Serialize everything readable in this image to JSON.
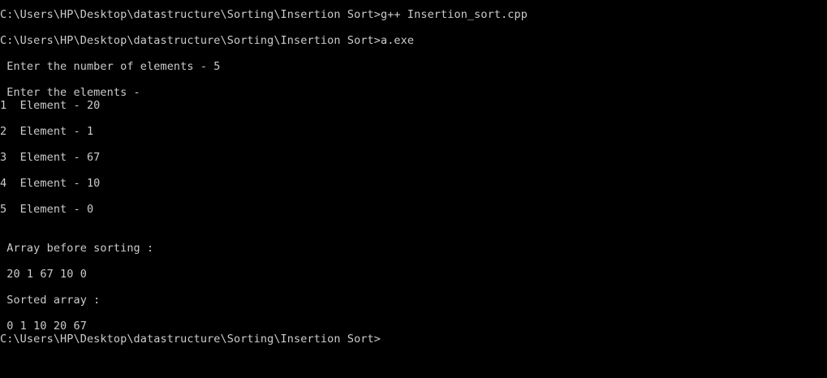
{
  "console": {
    "text_color": "#cccccc",
    "background_color": "#000000",
    "lines": [
      "C:\\Users\\HP\\Desktop\\datastructure\\Sorting\\Insertion Sort>g++ Insertion_sort.cpp",
      "",
      "C:\\Users\\HP\\Desktop\\datastructure\\Sorting\\Insertion Sort>a.exe",
      "",
      " Enter the number of elements - 5",
      "",
      " Enter the elements -",
      "1  Element - 20",
      "",
      "2  Element - 1",
      "",
      "3  Element - 67",
      "",
      "4  Element - 10",
      "",
      "5  Element - 0",
      "",
      "",
      " Array before sorting :",
      "",
      " 20 1 67 10 0",
      "",
      " Sorted array :",
      "",
      " 0 1 10 20 67",
      "C:\\Users\\HP\\Desktop\\datastructure\\Sorting\\Insertion Sort>"
    ]
  }
}
